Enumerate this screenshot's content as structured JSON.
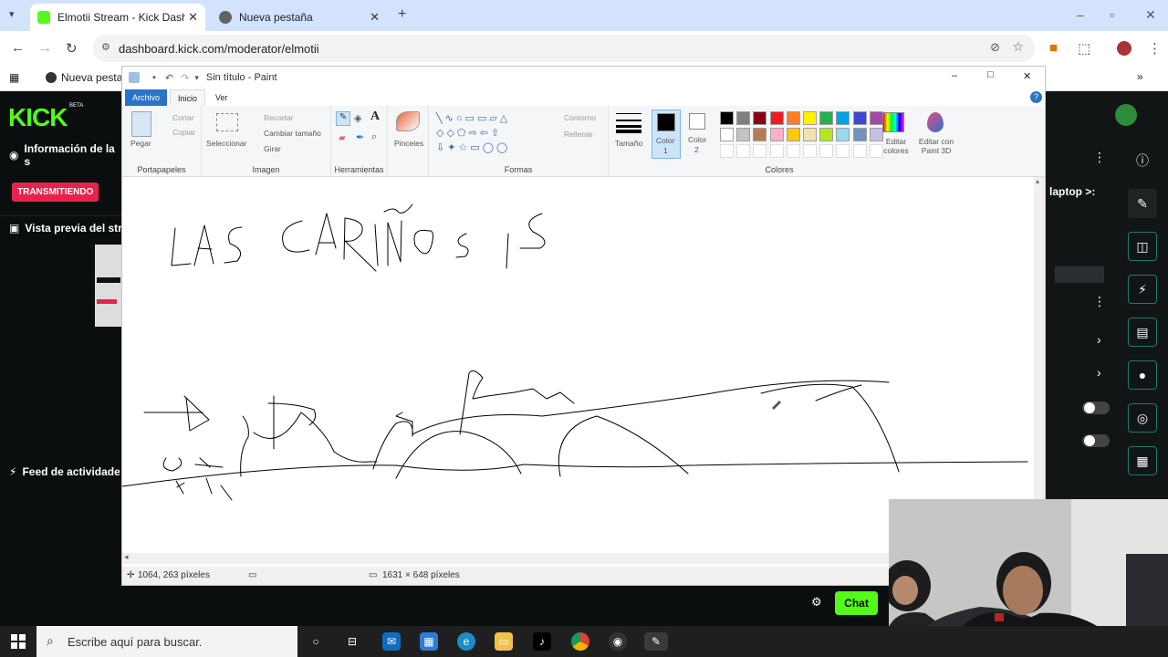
{
  "browser": {
    "tabs": [
      {
        "title": "Elmotii Stream - Kick Dashboard",
        "active": true
      },
      {
        "title": "Nueva pestaña",
        "active": false
      }
    ],
    "url": "dashboard.kick.com/moderator/elmotii",
    "bookmark": "Nueva pestaña"
  },
  "kick": {
    "logo": "KICK",
    "beta": "BETA",
    "info_label": "Información de la s",
    "live_badge": "TRANSMITIENDO",
    "preview_label": "Vista previa del str",
    "feed_label": "Feed de actividade",
    "right_text": "laptop >:",
    "chat_button": "Chat"
  },
  "paint": {
    "title": "Sin título - Paint",
    "tabs": [
      "Archivo",
      "Inicio",
      "Ver"
    ],
    "groups": {
      "portapapeles": {
        "label": "Portapapeles",
        "paste": "Pegar",
        "cut": "Cortar",
        "copy": "Copiar"
      },
      "imagen": {
        "label": "Imagen",
        "select": "Seleccionar",
        "crop": "Recortar",
        "resize": "Cambiar tamaño",
        "rotate": "Girar"
      },
      "herramientas": {
        "label": "Herramientas"
      },
      "pinceles": {
        "label": "Pinceles"
      },
      "formas": {
        "label": "Formas",
        "outline": "Contorno",
        "fill": "Rellenar"
      },
      "tamano": {
        "label": "Tamaño"
      },
      "color1": {
        "label": "Color",
        "sub": "1"
      },
      "color2": {
        "label": "Color",
        "sub": "2"
      },
      "colores": {
        "label": "Colores"
      },
      "editar_colores": {
        "label": "Editar colores"
      },
      "paint3d": {
        "label": "Editar con Paint 3D"
      }
    },
    "palette": [
      "#000000",
      "#7f7f7f",
      "#880015",
      "#ed1c24",
      "#ff7f27",
      "#fff200",
      "#22b14c",
      "#00a2e8",
      "#3f48cc",
      "#a349a4",
      "#ffffff",
      "#c3c3c3",
      "#b97a57",
      "#ffaec9",
      "#ffc90e",
      "#efe4b0",
      "#b5e61d",
      "#99d9ea",
      "#7092be",
      "#c8bfe7"
    ],
    "status": {
      "cursor": "1064, 263 píxeles",
      "size": "1631 × 648 píxeles"
    }
  },
  "taskbar": {
    "search_placeholder": "Escribe aquí para buscar."
  }
}
